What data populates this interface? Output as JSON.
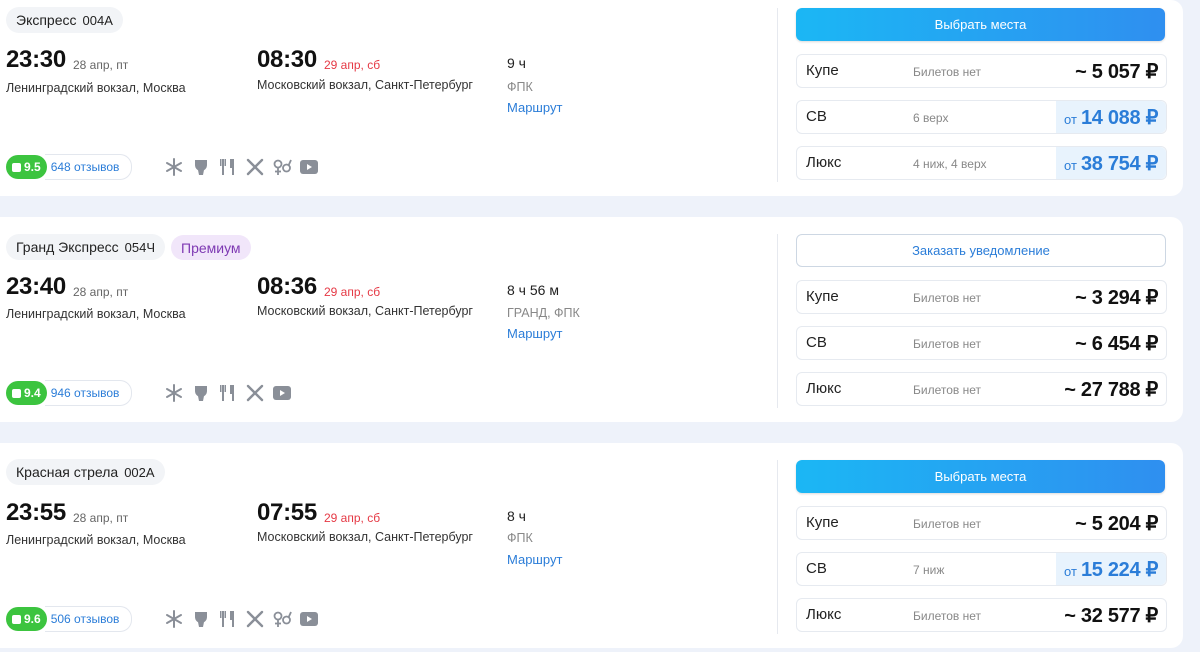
{
  "trains": [
    {
      "name": "Экспресс",
      "number": "004А",
      "dep_time": "23:30",
      "dep_date": "28 апр, пт",
      "dep_station": "Ленинградский вокзал, Москва",
      "arr_time": "08:30",
      "arr_date": "29 апр, сб",
      "arr_station": "Московский вокзал, Санкт-Петербург",
      "duration": "9 ч",
      "carrier": "ФПК",
      "route_link": "Маршрут",
      "rating": "9.5",
      "reviews": "648 отзывов",
      "amenities": [
        "snowflake-icon",
        "toilet-icon",
        "restaurant-icon",
        "meal-icon",
        "gender-icon",
        "tv-icon"
      ],
      "action": "Выбрать места",
      "fares": [
        {
          "class": "Купе",
          "info": "Билетов нет",
          "prefix": "",
          "price": "~ 5 057 ₽"
        },
        {
          "class": "СВ",
          "info": "6 верх",
          "prefix": "от",
          "price": "14 088 ₽"
        },
        {
          "class": "Люкс",
          "info": "4 ниж, 4 верх",
          "prefix": "от",
          "price": "38 754 ₽"
        }
      ]
    },
    {
      "name": "Гранд Экспресс",
      "number": "054Ч",
      "premium": "Премиум",
      "dep_time": "23:40",
      "dep_date": "28 апр, пт",
      "dep_station": "Ленинградский вокзал, Москва",
      "arr_time": "08:36",
      "arr_date": "29 апр, сб",
      "arr_station": "Московский вокзал, Санкт-Петербург",
      "duration": "8 ч 56 м",
      "carrier": "ГРАНД, ФПК",
      "route_link": "Маршрут",
      "rating": "9.4",
      "reviews": "946 отзывов",
      "amenities": [
        "snowflake-icon",
        "toilet-icon",
        "restaurant-icon",
        "meal-icon",
        "tv-icon"
      ],
      "action": "Заказать уведомление",
      "fares": [
        {
          "class": "Купе",
          "info": "Билетов нет",
          "prefix": "",
          "price": "~ 3 294 ₽"
        },
        {
          "class": "СВ",
          "info": "Билетов нет",
          "prefix": "",
          "price": "~ 6 454 ₽"
        },
        {
          "class": "Люкс",
          "info": "Билетов нет",
          "prefix": "",
          "price": "~ 27 788 ₽"
        }
      ]
    },
    {
      "name": "Красная стрела",
      "number": "002А",
      "dep_time": "23:55",
      "dep_date": "28 апр, пт",
      "dep_station": "Ленинградский вокзал, Москва",
      "arr_time": "07:55",
      "arr_date": "29 апр, сб",
      "arr_station": "Московский вокзал, Санкт-Петербург",
      "duration": "8 ч",
      "carrier": "ФПК",
      "route_link": "Маршрут",
      "rating": "9.6",
      "reviews": "506 отзывов",
      "amenities": [
        "snowflake-icon",
        "toilet-icon",
        "restaurant-icon",
        "meal-icon",
        "gender-icon",
        "tv-icon"
      ],
      "action": "Выбрать места",
      "fares": [
        {
          "class": "Купе",
          "info": "Билетов нет",
          "prefix": "",
          "price": "~ 5 204 ₽"
        },
        {
          "class": "СВ",
          "info": "7 ниж",
          "prefix": "от",
          "price": "15 224 ₽"
        },
        {
          "class": "Люкс",
          "info": "Билетов нет",
          "prefix": "",
          "price": "~ 32 577 ₽"
        }
      ]
    }
  ],
  "colors": {
    "accent_blue": "#2b7dd8",
    "button_gradient_start": "#1bb7f4",
    "button_gradient_end": "#2f8ff0",
    "rating_green": "#3cc43f",
    "arrival_date_red": "#e53945",
    "premium_purple": "#7e39b3"
  }
}
